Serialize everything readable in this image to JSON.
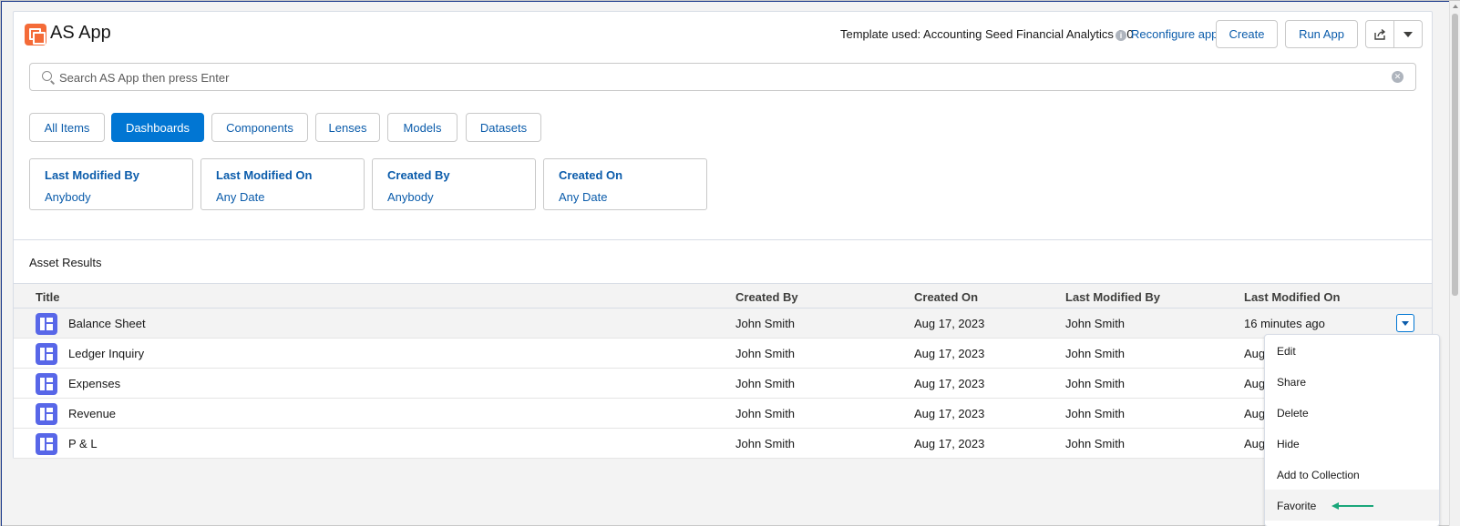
{
  "app": {
    "title": "AS App"
  },
  "header": {
    "template_text": "Template used: Accounting Seed Financial Analytics 1.0",
    "reconfigure_link": "Reconfigure app",
    "create_label": "Create",
    "run_label": "Run App"
  },
  "search": {
    "placeholder": "Search AS App then press Enter",
    "value": ""
  },
  "tabs": [
    {
      "label": "All Items",
      "active": false
    },
    {
      "label": "Dashboards",
      "active": true
    },
    {
      "label": "Components",
      "active": false
    },
    {
      "label": "Lenses",
      "active": false
    },
    {
      "label": "Models",
      "active": false
    },
    {
      "label": "Datasets",
      "active": false
    }
  ],
  "filters": [
    {
      "label": "Last Modified By",
      "value": "Anybody"
    },
    {
      "label": "Last Modified On",
      "value": "Any Date"
    },
    {
      "label": "Created By",
      "value": "Anybody"
    },
    {
      "label": "Created On",
      "value": "Any Date"
    }
  ],
  "results": {
    "heading": "Asset Results",
    "columns": [
      "Title",
      "Created By",
      "Created On",
      "Last Modified By",
      "Last Modified On"
    ],
    "rows": [
      {
        "title": "Balance Sheet",
        "created_by": "John Smith",
        "created_on": "Aug 17, 2023",
        "last_modified_by": "John Smith",
        "last_modified_on": "16 minutes ago"
      },
      {
        "title": "Ledger Inquiry",
        "created_by": "John Smith",
        "created_on": "Aug 17, 2023",
        "last_modified_by": "John Smith",
        "last_modified_on": "Aug"
      },
      {
        "title": "Expenses",
        "created_by": "John Smith",
        "created_on": "Aug 17, 2023",
        "last_modified_by": "John Smith",
        "last_modified_on": "Aug"
      },
      {
        "title": "Revenue",
        "created_by": "John Smith",
        "created_on": "Aug 17, 2023",
        "last_modified_by": "John Smith",
        "last_modified_on": "Aug"
      },
      {
        "title": "P & L",
        "created_by": "John Smith",
        "created_on": "Aug 17, 2023",
        "last_modified_by": "John Smith",
        "last_modified_on": "Aug"
      }
    ]
  },
  "row_menu": {
    "items": [
      "Edit",
      "Share",
      "Delete",
      "Hide",
      "Add to Collection",
      "Favorite"
    ],
    "highlighted": "Favorite"
  },
  "colors": {
    "brand_icon": "#f46b38",
    "dashboard_icon": "#5867e8",
    "link": "#0b5cab",
    "active_tab": "#0176d3",
    "annotation_arrow": "#1aa77a"
  }
}
